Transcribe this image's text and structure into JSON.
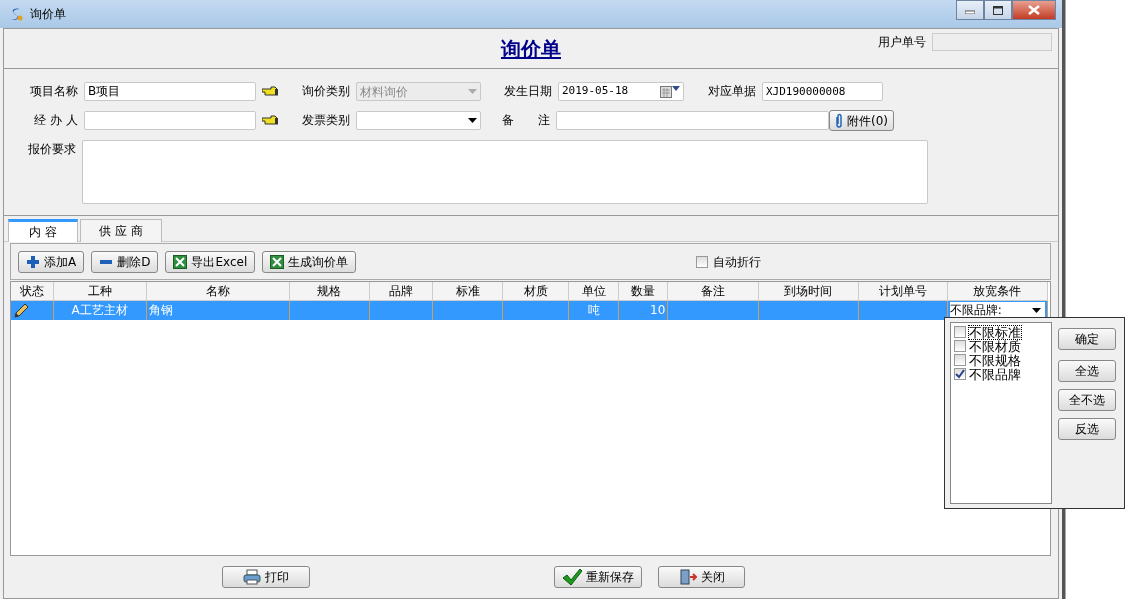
{
  "window": {
    "title": "询价单"
  },
  "header": {
    "title": "询价单",
    "user_no_label": "用户单号"
  },
  "form_rows": [
    [
      {
        "kind": "text",
        "label": "项目名称",
        "value": "B项目",
        "lookup": true
      },
      {
        "kind": "combo",
        "label": "询价类别",
        "value": "材料询价",
        "disabled": true
      },
      {
        "kind": "date",
        "label": "发生日期",
        "value": "2019-05-18"
      },
      {
        "kind": "text",
        "label": "对应单据",
        "value": "XJD190000008",
        "mono": true
      }
    ],
    [
      {
        "kind": "text",
        "label": "经 办 人",
        "lookup": true
      },
      {
        "kind": "combo",
        "label": "发票类别",
        "disabled": false
      },
      {
        "kind": "text",
        "label": "备　　注"
      },
      {
        "kind": "button",
        "label": "附件(0)"
      }
    ],
    [
      {
        "kind": "textarea",
        "label": "报价要求"
      }
    ]
  ],
  "tabs": [
    {
      "label": "内 容",
      "selected": true
    },
    {
      "label": "供 应 商",
      "selected": false
    }
  ],
  "toolbar": [
    {
      "label": "添加A",
      "kind": "add"
    },
    {
      "label": "删除D",
      "kind": "remove"
    },
    {
      "label": "导出Excel",
      "kind": "excel"
    },
    {
      "label": "生成询价单",
      "kind": "excel"
    }
  ],
  "auto_wrap": {
    "label": "自动折行",
    "checked": false
  },
  "table": {
    "columns": [
      "状态",
      "工种",
      "名称",
      "规格",
      "品牌",
      "标准",
      "材质",
      "单位",
      "数量",
      "备注",
      "到场时间",
      "计划单号",
      "放宽条件"
    ],
    "rows": [
      {
        "selected": true,
        "editing": true,
        "cells": [
          "",
          "A工艺主材",
          "角钢",
          "",
          "",
          "",
          "",
          "吨",
          "10",
          "",
          "",
          "",
          "不限品牌:"
        ]
      }
    ]
  },
  "popup": {
    "items": [
      {
        "label": "不限标准",
        "checked": false,
        "focused": true
      },
      {
        "label": "不限材质",
        "checked": false,
        "focused": false
      },
      {
        "label": "不限规格",
        "checked": false,
        "focused": false
      },
      {
        "label": "不限品牌",
        "checked": true,
        "focused": false
      }
    ],
    "buttons": [
      "确定",
      "全选",
      "全不选",
      "反选"
    ]
  },
  "footer": [
    {
      "label": "打印",
      "kind": "print"
    },
    {
      "label": "重新保存",
      "kind": "save"
    },
    {
      "label": "关闭",
      "kind": "close"
    }
  ]
}
